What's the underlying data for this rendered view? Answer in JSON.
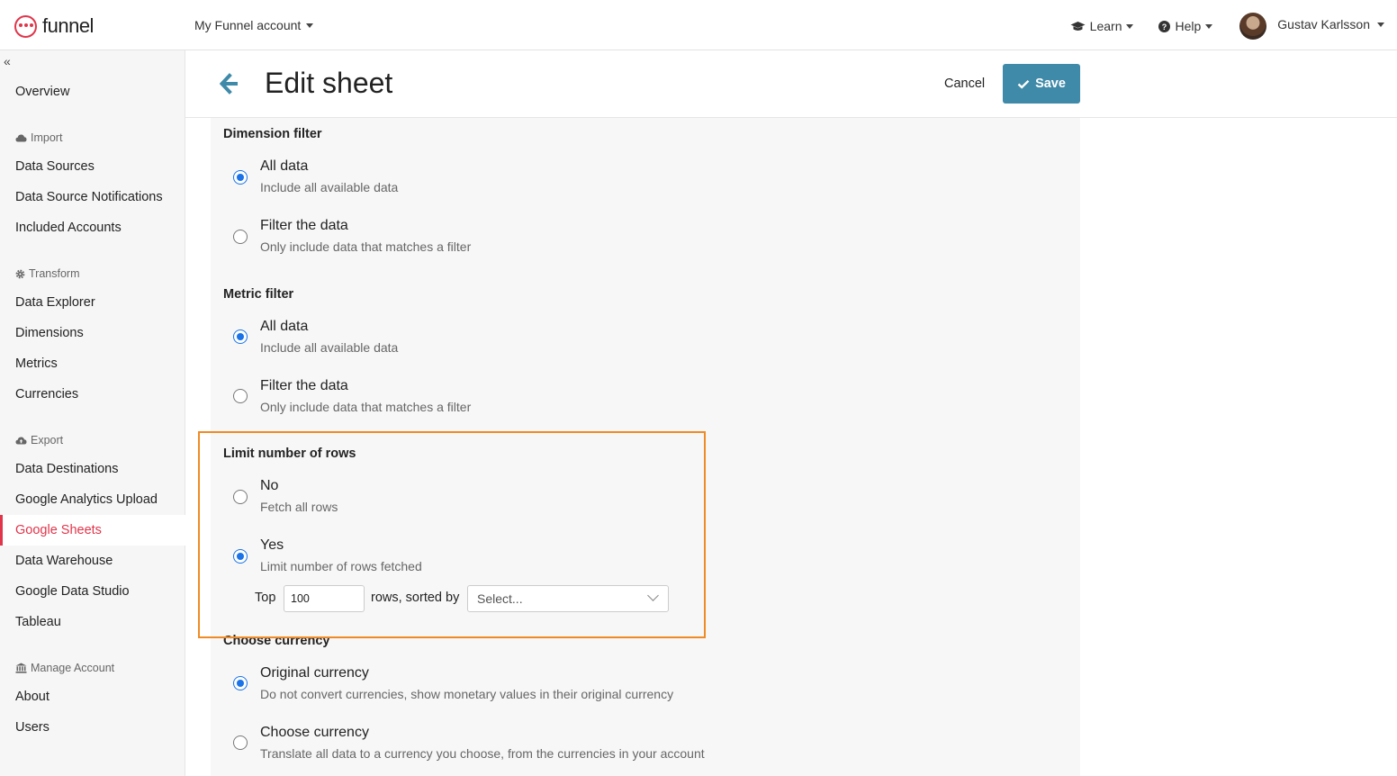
{
  "header": {
    "logo_text": "funnel",
    "account_label": "My Funnel account",
    "learn_label": "Learn",
    "help_label": "Help",
    "user_name": "Gustav Karlsson"
  },
  "sidebar": {
    "collapse_icon": "«",
    "overview": "Overview",
    "import_group": "Import",
    "data_sources": "Data Sources",
    "data_source_notifications": "Data Source Notifications",
    "included_accounts": "Included Accounts",
    "transform_group": "Transform",
    "data_explorer": "Data Explorer",
    "dimensions": "Dimensions",
    "metrics": "Metrics",
    "currencies": "Currencies",
    "export_group": "Export",
    "data_destinations": "Data Destinations",
    "google_analytics_upload": "Google Analytics Upload",
    "google_sheets": "Google Sheets",
    "data_warehouse": "Data Warehouse",
    "google_data_studio": "Google Data Studio",
    "tableau": "Tableau",
    "manage_group": "Manage Account",
    "about": "About",
    "users": "Users"
  },
  "page": {
    "title": "Edit sheet",
    "cancel_label": "Cancel",
    "save_label": "Save"
  },
  "dimension_filter": {
    "title": "Dimension filter",
    "opt1_title": "All data",
    "opt1_desc": "Include all available data",
    "opt2_title": "Filter the data",
    "opt2_desc": "Only include data that matches a filter",
    "selected": "All data"
  },
  "metric_filter": {
    "title": "Metric filter",
    "opt1_title": "All data",
    "opt1_desc": "Include all available data",
    "opt2_title": "Filter the data",
    "opt2_desc": "Only include data that matches a filter",
    "selected": "All data"
  },
  "limit_rows": {
    "title": "Limit number of rows",
    "opt1_title": "No",
    "opt1_desc": "Fetch all rows",
    "opt2_title": "Yes",
    "opt2_desc": "Limit number of rows fetched",
    "selected": "Yes",
    "top_label": "Top",
    "rows_value": "100",
    "sorted_label": "rows, sorted by",
    "sort_placeholder": "Select..."
  },
  "currency": {
    "title": "Choose currency",
    "opt1_title": "Original currency",
    "opt1_desc": "Do not convert currencies, show monetary values in their original currency",
    "opt2_title": "Choose currency",
    "opt2_desc": "Translate all data to a currency you choose, from the currencies in your account",
    "selected": "Original currency"
  },
  "colors": {
    "brand": "#e0354a",
    "save_button": "#3f8aa8",
    "radio_selected": "#1a73e8",
    "highlight_border": "#f08a24"
  }
}
